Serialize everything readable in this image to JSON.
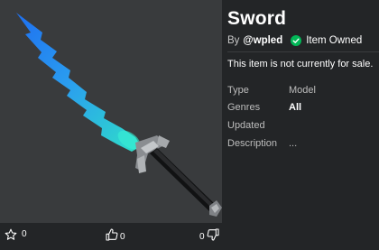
{
  "item": {
    "title": "Sword",
    "by_prefix": "By",
    "creator": "@wpled",
    "owned_label": "Item Owned",
    "sale_status": "This item is not currently for sale."
  },
  "details": [
    {
      "label": "Type",
      "value": "Model"
    },
    {
      "label": "Genres",
      "value": "All"
    },
    {
      "label": "Updated",
      "value": ""
    },
    {
      "label": "Description",
      "value": "..."
    }
  ],
  "stats": {
    "favorites": "0",
    "upvotes": "0",
    "downvotes": "0"
  },
  "icons": {
    "favorite": "star-outline-icon",
    "upvote": "thumbs-up-icon",
    "downvote": "thumbs-down-icon",
    "owned": "check-circle-icon"
  },
  "colors": {
    "background": "#232527",
    "thumbnail_bg": "#393b3d",
    "owned_green": "#02b757",
    "blade_top": "#1e7df5",
    "blade_bottom": "#2ee6c8"
  }
}
